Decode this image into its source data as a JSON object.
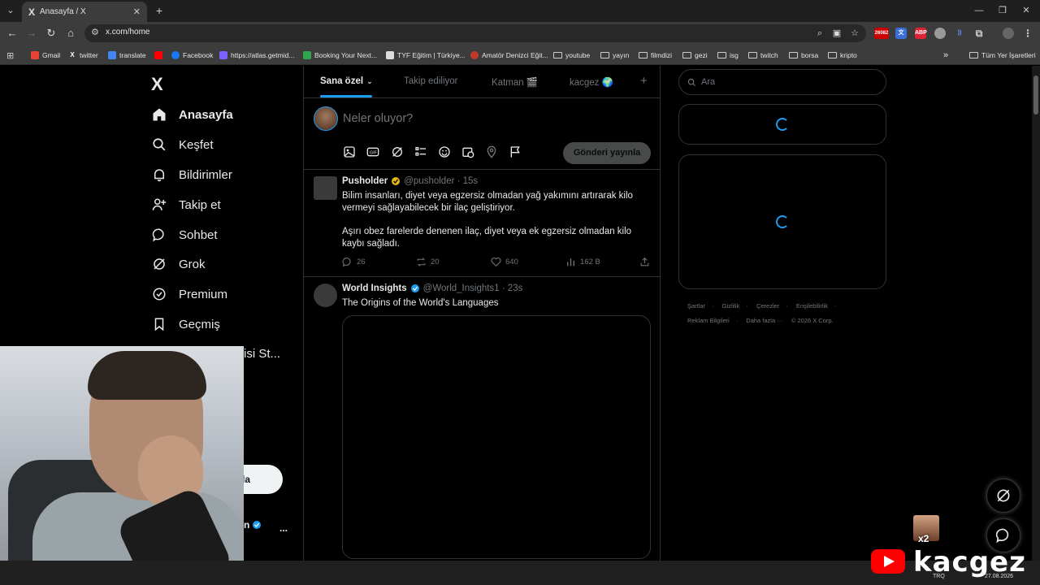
{
  "browser": {
    "tab_title": "Anasayfa / X",
    "tab_logo": "X",
    "url": "x.com/home",
    "bookmarks": [
      {
        "label": "Gmail",
        "icon": "gmail-icon",
        "color": "#ea4335"
      },
      {
        "label": "twitter",
        "icon": "x-icon",
        "color": "#ffffff"
      },
      {
        "label": "translate",
        "icon": "translate-icon",
        "color": "#4285f4"
      },
      {
        "label": "",
        "icon": "youtube-icon",
        "color": "#ff0000"
      },
      {
        "label": "Facebook",
        "icon": "facebook-icon",
        "color": "#1877f2"
      },
      {
        "label": "https://atlas.getmid...",
        "icon": "atlas-icon",
        "color": "#7b61ff"
      },
      {
        "label": "Booking Your Next...",
        "icon": "booking-icon",
        "color": "#2ea44f"
      },
      {
        "label": "TYF Eğitim | Türkiye...",
        "icon": "doc-icon",
        "color": "#dddddd"
      },
      {
        "label": "Amatör Denizci Eğit...",
        "icon": "anchor-icon",
        "color": "#c0392b"
      },
      {
        "label": "youtube",
        "icon": "folder-icon"
      },
      {
        "label": "yayın",
        "icon": "folder-icon"
      },
      {
        "label": "filmdizi",
        "icon": "folder-icon"
      },
      {
        "label": "gezi",
        "icon": "folder-icon"
      },
      {
        "label": "isg",
        "icon": "folder-icon"
      },
      {
        "label": "twitch",
        "icon": "folder-icon"
      },
      {
        "label": "borsa",
        "icon": "folder-icon"
      },
      {
        "label": "kripto",
        "icon": "folder-icon"
      }
    ],
    "all_bookmarks": "Tüm Yer İşaretleri",
    "ext_badge": "26082"
  },
  "nav": {
    "logo": "X",
    "items": [
      {
        "label": "Anasayfa",
        "icon": "home-icon"
      },
      {
        "label": "Keşfet",
        "icon": "search-icon"
      },
      {
        "label": "Bildirimler",
        "icon": "bell-icon"
      },
      {
        "label": "Takip et",
        "icon": "follow-icon"
      },
      {
        "label": "Sohbet",
        "icon": "chat-icon"
      },
      {
        "label": "Grok",
        "icon": "grok-icon"
      },
      {
        "label": "Premium",
        "icon": "premium-icon"
      },
      {
        "label": "Geçmiş",
        "icon": "bookmark-icon"
      }
    ],
    "partial_item": "isi St...",
    "post_button_partial": "la",
    "profile_partial": "n",
    "more": "..."
  },
  "tabs": [
    {
      "label": "Sana özel"
    },
    {
      "label": "Takip ediliyor"
    },
    {
      "label": "Katman 🎬"
    },
    {
      "label": "kacgez 🌍"
    }
  ],
  "tabs_plus": "+",
  "composer": {
    "placeholder": "Neler oluyor?",
    "post_button": "Gönderi yayınla"
  },
  "tweets": [
    {
      "name": "Pusholder",
      "handle": "@pusholder · 15s",
      "badge": "gold",
      "text1": "Bilim insanları, diyet veya egzersiz olmadan yağ yakımını artırarak kilo vermeyi sağlayabilecek bir ilaç geliştiriyor.",
      "text2": "Aşırı obez farelerde denenen ilaç, diyet veya ek egzersiz olmadan kilo kaybı sağladı.",
      "replies": "26",
      "reposts": "20",
      "likes": "640",
      "views": "162 B"
    },
    {
      "name": "World Insights",
      "handle": "@World_Insights1 · 23s",
      "badge": "blue",
      "text1": "The Origins of the World's Languages"
    }
  ],
  "search": {
    "placeholder": "Ara"
  },
  "footer": {
    "row1": [
      "Şartlar",
      "·",
      "Gizlilik",
      "·",
      "Çerezler",
      "·",
      "Erişilebilirlik",
      "·"
    ],
    "row2": [
      "Reklam Bilgileri",
      "·",
      "Daha fazla ···",
      "© 2026 X Corp."
    ]
  },
  "overlay": {
    "emote_count": "x2",
    "brand": "kacgez",
    "taskbar_lang": "TRQ",
    "taskbar_date": "27.08.2026"
  },
  "colors": {
    "accent": "#1d9bf0",
    "gold_badge": "#e2b719",
    "border": "#2f3336",
    "muted": "#71767b"
  }
}
